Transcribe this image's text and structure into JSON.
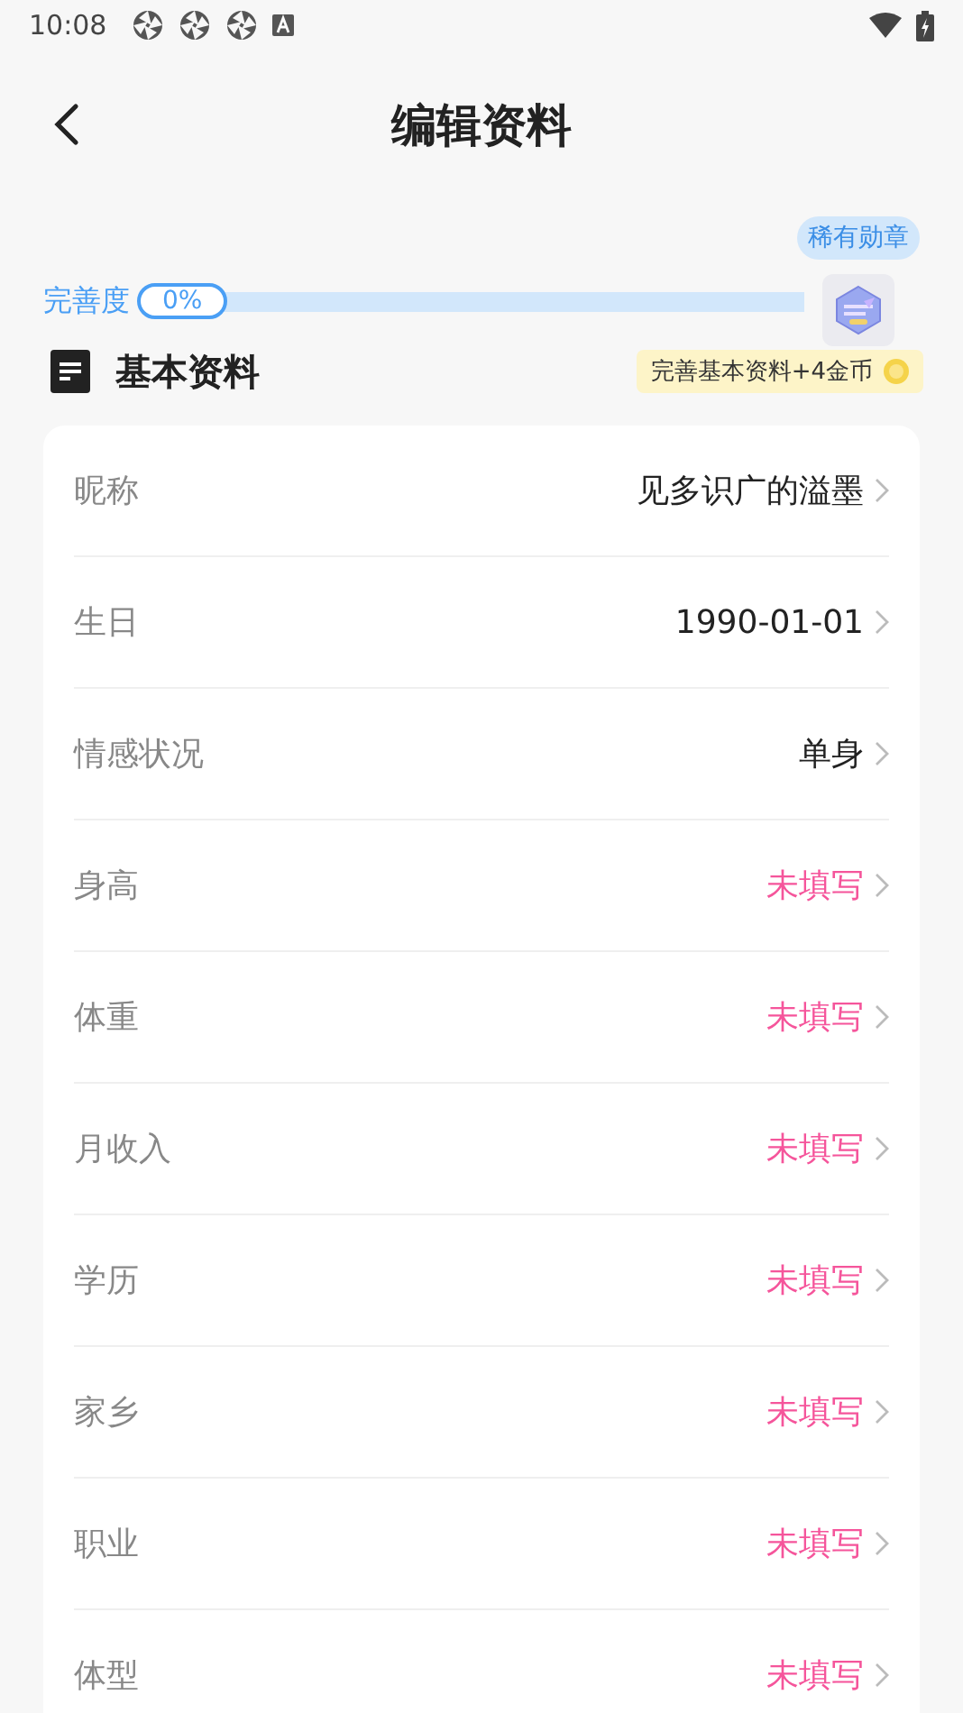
{
  "status_bar": {
    "time": "10:08"
  },
  "header": {
    "title": "编辑资料"
  },
  "progress": {
    "label": "完善度",
    "reading": "0%",
    "level": 0,
    "badge_tip": "稀有勋章"
  },
  "section": {
    "title": "基本资料",
    "reward": "完善基本资料+4金币"
  },
  "rows": [
    {
      "label": "昵称",
      "value": "见多识广的溢墨",
      "filled": true
    },
    {
      "label": "生日",
      "value": "1990-01-01",
      "filled": true
    },
    {
      "label": "情感状况",
      "value": "单身",
      "filled": true
    },
    {
      "label": "身高",
      "value": "未填写",
      "filled": false
    },
    {
      "label": "体重",
      "value": "未填写",
      "filled": false
    },
    {
      "label": "月收入",
      "value": "未填写",
      "filled": false
    },
    {
      "label": "学历",
      "value": "未填写",
      "filled": false
    },
    {
      "label": "家乡",
      "value": "未填写",
      "filled": false
    },
    {
      "label": "职业",
      "value": "未填写",
      "filled": false
    },
    {
      "label": "体型",
      "value": "未填写",
      "filled": false
    }
  ]
}
